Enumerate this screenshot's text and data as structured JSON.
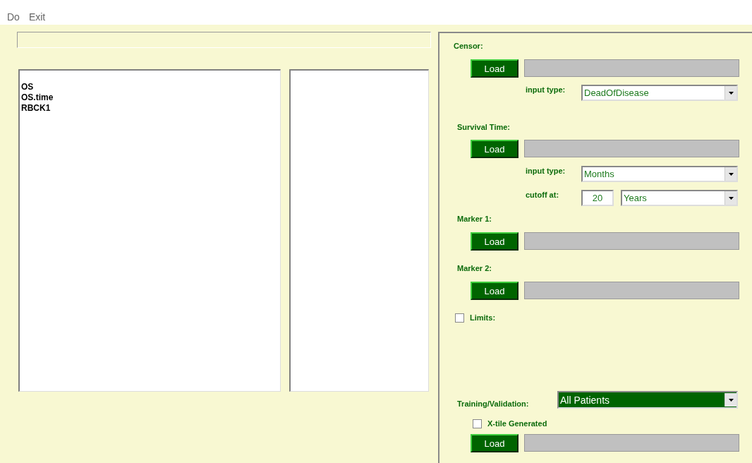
{
  "menu": [
    {
      "label": "Do"
    },
    {
      "label": "Exit"
    }
  ],
  "variables": {
    "items": [
      "OS",
      "OS.time",
      "RBCK1"
    ]
  },
  "panel": {
    "censor": {
      "label": "Censor:",
      "button": "Load",
      "input_type": {
        "label": "input type:",
        "value": "DeadOfDisease"
      }
    },
    "survival_time": {
      "label": "Survival Time:",
      "button": "Load",
      "input_type": {
        "label": "input type:",
        "value": "Months"
      },
      "cutoff": {
        "label": "cutoff at:",
        "value": "20",
        "unit": "Years"
      }
    },
    "markers": [
      {
        "label": "Marker 1:",
        "button": "Load"
      },
      {
        "label": "Marker 2:",
        "button": "Load"
      }
    ],
    "limits": {
      "label": "Limits:",
      "checked": false
    },
    "training_validation": {
      "label": "Training/Validation:",
      "value": "All Patients"
    },
    "xtile_generated": {
      "label": "X-tile Generated",
      "checked": false,
      "button": "Load"
    }
  }
}
